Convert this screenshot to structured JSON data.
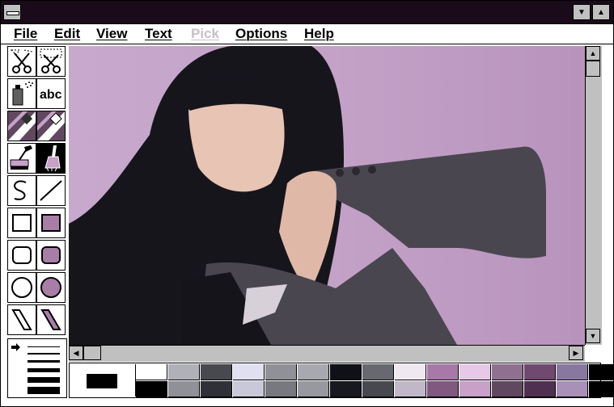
{
  "app": {
    "title": ""
  },
  "menu": [
    {
      "label": "File",
      "enabled": true
    },
    {
      "label": "Edit",
      "enabled": true
    },
    {
      "label": "View",
      "enabled": true
    },
    {
      "label": "Text",
      "enabled": true
    },
    {
      "label": "Pick",
      "enabled": false
    },
    {
      "label": "Options",
      "enabled": true
    },
    {
      "label": "Help",
      "enabled": true
    }
  ],
  "tools": [
    {
      "name": "scissors-free-select-icon"
    },
    {
      "name": "scissors-rect-select-icon"
    },
    {
      "name": "airbrush-icon"
    },
    {
      "name": "text-tool-icon",
      "label": "abc"
    },
    {
      "name": "color-eraser-icon"
    },
    {
      "name": "eraser-icon"
    },
    {
      "name": "paint-roller-icon"
    },
    {
      "name": "brush-icon",
      "selected": true
    },
    {
      "name": "curve-icon"
    },
    {
      "name": "line-icon"
    },
    {
      "name": "rectangle-icon"
    },
    {
      "name": "filled-rectangle-icon"
    },
    {
      "name": "rounded-rectangle-icon"
    },
    {
      "name": "filled-rounded-rectangle-icon"
    },
    {
      "name": "ellipse-icon"
    },
    {
      "name": "filled-ellipse-icon"
    },
    {
      "name": "polygon-icon"
    },
    {
      "name": "filled-polygon-icon"
    }
  ],
  "colors": {
    "titlebar": "#1a0a1a",
    "foreground": "#000000",
    "background": "#ffffff",
    "palette_top": [
      "#ffffff",
      "#b0b0b8",
      "#48484f",
      "#e0e0f0",
      "#909098",
      "#a8a8b0",
      "#101018",
      "#686870",
      "#f0e8f0",
      "#a878a8",
      "#e8c8e8",
      "#907090",
      "#704870",
      "#8878a0",
      "#000000"
    ],
    "palette_bottom": [
      "#000000",
      "#909098",
      "#303038",
      "#c8c8d8",
      "#787880",
      "#9898a0",
      "#181820",
      "#484850",
      "#c0b8c8",
      "#805880",
      "#c8a0c8",
      "#604860",
      "#503050",
      "#a890b8",
      "#000000"
    ]
  }
}
